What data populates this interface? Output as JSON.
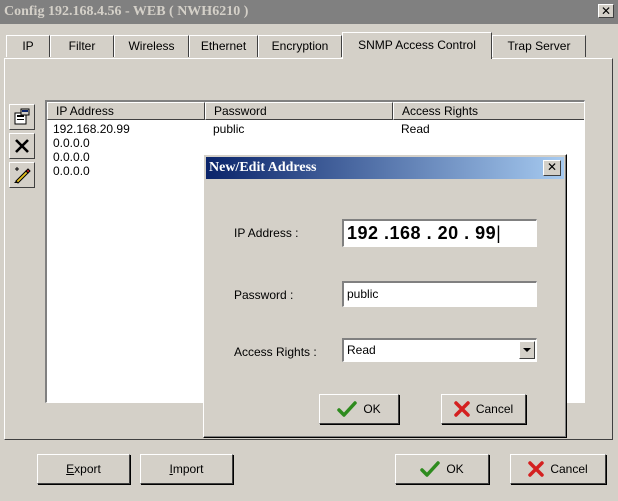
{
  "window": {
    "title": "Config 192.168.4.56 - WEB ( NWH6210 )",
    "close_glyph": "✕"
  },
  "tabs": [
    "IP",
    "Filter",
    "Wireless",
    "Ethernet",
    "Encryption",
    "SNMP Access Control",
    "Trap Server"
  ],
  "active_tab": "SNMP Access Control",
  "toolbar": {
    "icons": [
      "edit-properties-icon",
      "delete-icon",
      "edit-pencil-icon"
    ]
  },
  "table": {
    "columns": [
      "IP Address",
      "Password",
      "Access Rights"
    ],
    "rows": [
      {
        "ip": "192.168.20.99",
        "password": "public",
        "rights": "Read"
      },
      {
        "ip": "0.0.0.0",
        "password": "",
        "rights": ""
      },
      {
        "ip": "0.0.0.0",
        "password": "",
        "rights": ""
      },
      {
        "ip": "0.0.0.0",
        "password": "",
        "rights": ""
      }
    ]
  },
  "bottom": {
    "export_label": "Export",
    "export_access_key": "E",
    "export_rest": "xport",
    "import_access_key": "I",
    "import_rest": "mport",
    "ok_label": "OK",
    "cancel_label": "Cancel"
  },
  "dialog": {
    "title": "New/Edit Address",
    "close_glyph": "✕",
    "ip_label": "IP Address :",
    "ip_value": "192 .168 . 20 . 99",
    "password_label": "Password :",
    "password_value": "public",
    "rights_label": "Access Rights :",
    "rights_value": "Read",
    "ok_label": "OK",
    "cancel_label": "Cancel"
  },
  "colors": {
    "face": "#d4d0c8",
    "dialog_title_start": "#0a246a",
    "dialog_title_end": "#a6caf0",
    "ok_check": "#2e8b1e",
    "cancel_x": "#d42020"
  }
}
